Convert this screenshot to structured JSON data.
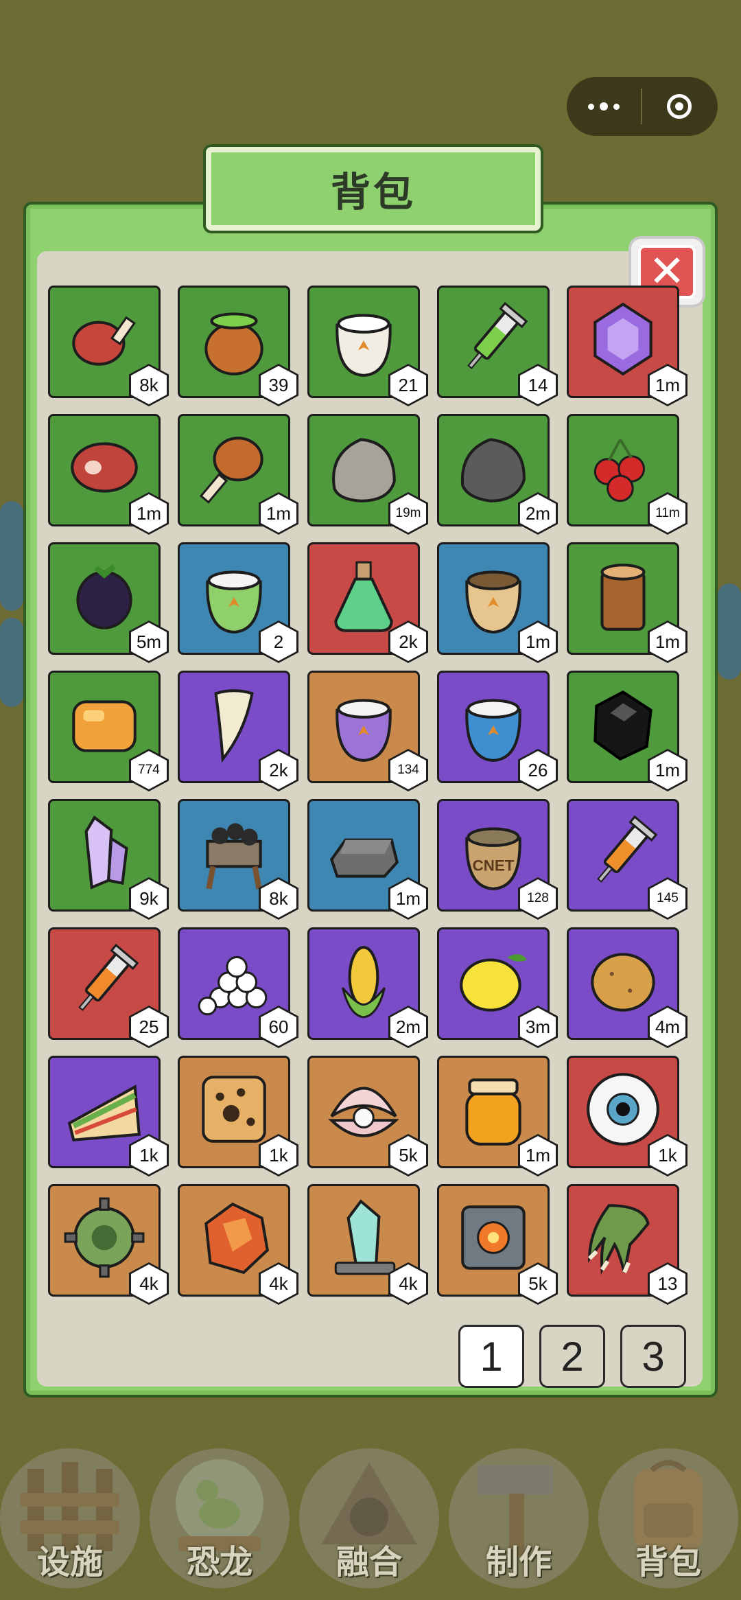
{
  "window": {
    "title": "背包"
  },
  "capsule": {
    "menu_icon": "more-dots-icon",
    "close_icon": "target-circle-icon"
  },
  "inventory": {
    "close_icon": "close-x-icon",
    "items": [
      {
        "name": "ham-leg",
        "color": "green",
        "count": "8k"
      },
      {
        "name": "green-potion-pot",
        "color": "green",
        "count": "39"
      },
      {
        "name": "white-seed-sack",
        "color": "green",
        "count": "21"
      },
      {
        "name": "green-syringe",
        "color": "green",
        "count": "14"
      },
      {
        "name": "purple-gem",
        "color": "red",
        "count": "1m"
      },
      {
        "name": "raw-steak",
        "color": "green",
        "count": "1m"
      },
      {
        "name": "roast-drumstick",
        "color": "green",
        "count": "1m"
      },
      {
        "name": "gray-stone",
        "color": "green",
        "count": "19m"
      },
      {
        "name": "dark-ore",
        "color": "green",
        "count": "2m"
      },
      {
        "name": "red-berries",
        "color": "green",
        "count": "11m"
      },
      {
        "name": "blackberry",
        "color": "green",
        "count": "5m"
      },
      {
        "name": "green-seed-sack",
        "color": "blue",
        "count": "2"
      },
      {
        "name": "green-flask",
        "color": "red",
        "count": "2k"
      },
      {
        "name": "grain-sack",
        "color": "blue",
        "count": "1m"
      },
      {
        "name": "wood-log",
        "color": "green",
        "count": "1m"
      },
      {
        "name": "amber-chunk",
        "color": "green",
        "count": "774"
      },
      {
        "name": "dino-fang",
        "color": "purple",
        "count": "2k"
      },
      {
        "name": "purple-seed-sack",
        "color": "orange",
        "count": "134"
      },
      {
        "name": "blue-seed-sack",
        "color": "purple",
        "count": "26"
      },
      {
        "name": "black-crystal",
        "color": "green",
        "count": "1m"
      },
      {
        "name": "quartz-crystal",
        "color": "green",
        "count": "9k"
      },
      {
        "name": "coal-cart",
        "color": "blue",
        "count": "8k"
      },
      {
        "name": "iron-ingot",
        "color": "blue",
        "count": "1m"
      },
      {
        "name": "cnet-sack",
        "color": "purple",
        "count": "128",
        "label": "CNET"
      },
      {
        "name": "dart-syringe",
        "color": "purple",
        "count": "145"
      },
      {
        "name": "orange-syringe",
        "color": "red",
        "count": "25"
      },
      {
        "name": "egg-pile",
        "color": "purple",
        "count": "60"
      },
      {
        "name": "corn",
        "color": "purple",
        "count": "2m"
      },
      {
        "name": "lemon",
        "color": "purple",
        "count": "3m"
      },
      {
        "name": "potato",
        "color": "purple",
        "count": "4m"
      },
      {
        "name": "sandwich-slice",
        "color": "purple",
        "count": "1k"
      },
      {
        "name": "leopard-hide",
        "color": "orange",
        "count": "1k"
      },
      {
        "name": "pearl-shell",
        "color": "orange",
        "count": "5k"
      },
      {
        "name": "honey-jar",
        "color": "orange",
        "count": "1m"
      },
      {
        "name": "eyeball",
        "color": "red",
        "count": "1k"
      },
      {
        "name": "virus-gear",
        "color": "orange",
        "count": "4k"
      },
      {
        "name": "lava-rock",
        "color": "orange",
        "count": "4k"
      },
      {
        "name": "ice-crystal",
        "color": "orange",
        "count": "4k"
      },
      {
        "name": "core-cube",
        "color": "orange",
        "count": "5k"
      },
      {
        "name": "dino-claw",
        "color": "red",
        "count": "13"
      }
    ]
  },
  "pager": {
    "pages": [
      "1",
      "2",
      "3"
    ],
    "active": "1"
  },
  "nav": [
    {
      "label": "设施",
      "icon": "fence-icon"
    },
    {
      "label": "恐龙",
      "icon": "dino-dome-icon"
    },
    {
      "label": "融合",
      "icon": "fusion-triangle-icon"
    },
    {
      "label": "制作",
      "icon": "hammer-icon"
    },
    {
      "label": "背包",
      "icon": "backpack-icon"
    }
  ],
  "colors": {
    "green": "#4f9a3c",
    "red": "#c84a46",
    "blue": "#3f87b3",
    "purple": "#7a4cc7",
    "orange": "#c98a4b",
    "panel": "#8fd16e",
    "inner": "#d9d5c4"
  }
}
